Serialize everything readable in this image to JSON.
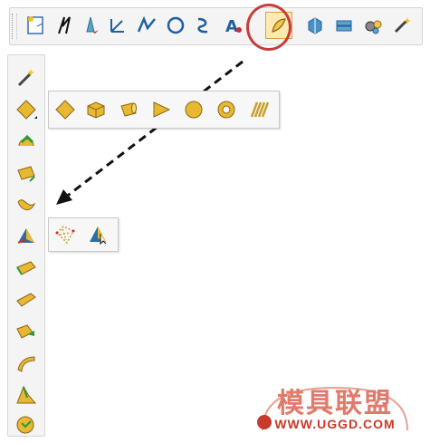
{
  "toolbar": {
    "items": [
      {
        "name": "display-icon"
      },
      {
        "name": "axis-switch-icon"
      },
      {
        "name": "point-icon"
      },
      {
        "name": "coordinate-axis-icon"
      },
      {
        "name": "line-icon"
      },
      {
        "name": "circle-icon"
      },
      {
        "name": "spline-icon"
      },
      {
        "name": "text-icon"
      },
      {
        "name": "surface-icon"
      },
      {
        "name": "solid-icon"
      },
      {
        "name": "extrude-icon"
      },
      {
        "name": "gear-tools-icon"
      },
      {
        "name": "magic-wand-icon"
      }
    ]
  },
  "sidebar": {
    "items": [
      {
        "name": "wand-icon"
      },
      {
        "name": "diamond-solid-icon"
      },
      {
        "name": "revolve-icon"
      },
      {
        "name": "extrude-cylinder-icon"
      },
      {
        "name": "swept-surface-icon"
      },
      {
        "name": "surface-fit-icon"
      },
      {
        "name": "ruled-surface-icon"
      },
      {
        "name": "loft-icon"
      },
      {
        "name": "offset-icon"
      },
      {
        "name": "curved-surface-icon"
      },
      {
        "name": "draft-icon"
      },
      {
        "name": "globe-tool-icon"
      }
    ]
  },
  "flyout_primitives": {
    "items": [
      {
        "name": "diamond-icon"
      },
      {
        "name": "box-icon"
      },
      {
        "name": "cylinder-icon"
      },
      {
        "name": "cone-icon"
      },
      {
        "name": "sphere-icon"
      },
      {
        "name": "torus-icon"
      },
      {
        "name": "spring-icon"
      }
    ]
  },
  "flyout_surface": {
    "items": [
      {
        "name": "mesh-surface-icon"
      },
      {
        "name": "surface-select-icon"
      }
    ]
  },
  "watermark": {
    "title": "模具联盟",
    "url": "WWW.UGGD.COM"
  },
  "colors": {
    "accent": "#e8b830",
    "highlight_circle": "#c73d3d",
    "watermark_text": "#e07a6a",
    "watermark_url": "#c83a2a"
  }
}
